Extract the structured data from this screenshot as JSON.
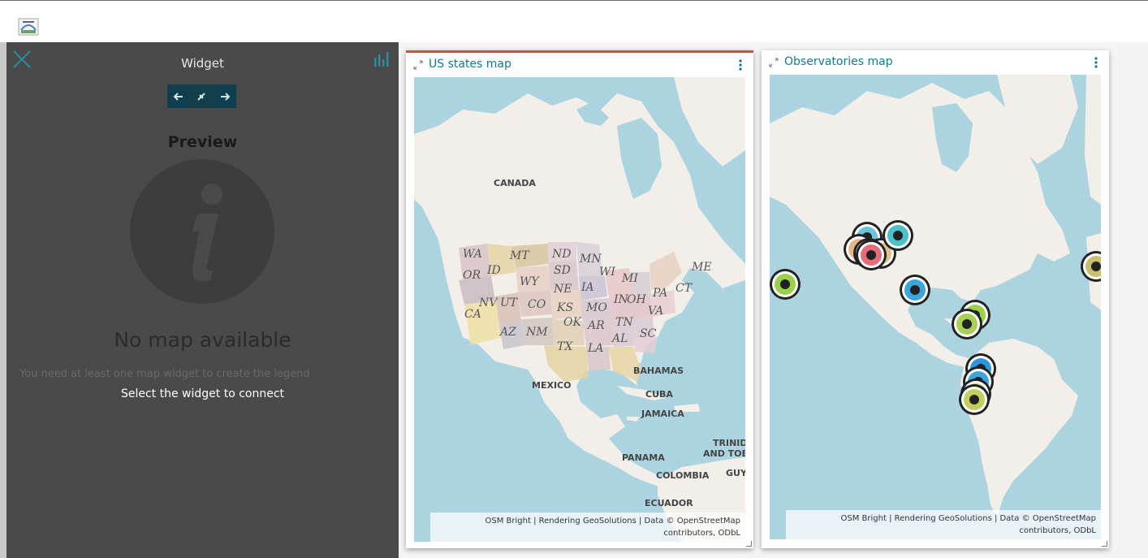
{
  "panel": {
    "title": "Widget",
    "preview": "Preview",
    "no_map": "No map available",
    "need": "You need at least one map widget to create the legend",
    "select": "Select the widget to connect"
  },
  "cards": [
    {
      "title": "US states map",
      "attribution": [
        "OSM Bright | Rendering GeoSolutions | Data © OpenStreetMap",
        "contributors, ODbL"
      ]
    },
    {
      "title": "Observatories map",
      "attribution": [
        "OSM Bright | Rendering GeoSolutions | Data © OpenStreetMap",
        "contributors, ODbL"
      ]
    }
  ],
  "map1_labels": {
    "countries": [
      "CANADA",
      "MEXICO",
      "BAHAMAS",
      "CUBA",
      "JAMAICA",
      "PANAMA",
      "COLOMBIA",
      "ECUADOR",
      "TRINID",
      "AND TOB",
      "GUY."
    ],
    "states": [
      "WA",
      "MT",
      "ND",
      "MN",
      "ID",
      "OR",
      "SD",
      "WI",
      "MI",
      "ME",
      "WY",
      "NE",
      "IA",
      "NV",
      "UT",
      "CO",
      "KS",
      "MO",
      "IN",
      "OH",
      "PA",
      "CT",
      "CA",
      "OK",
      "AR",
      "TN",
      "VA",
      "AZ",
      "NM",
      "TX",
      "AL",
      "SC",
      "LA"
    ]
  },
  "colors": {
    "accent": "#137a8c",
    "panel": "#4a4a4a",
    "nav": "#0f3f4e",
    "active_border": "#b85c3d",
    "water": "#acd3e0",
    "land": "#f2efe9"
  }
}
